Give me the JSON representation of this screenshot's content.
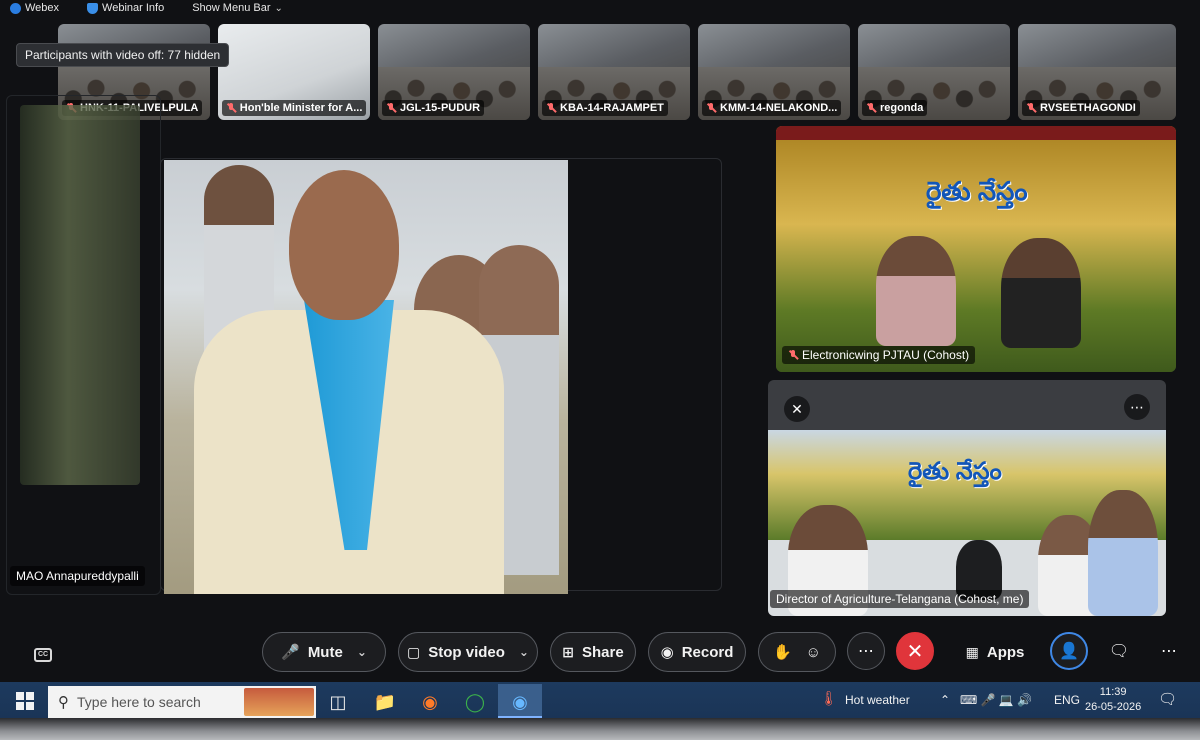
{
  "menubar": {
    "app_name": "Webex",
    "webinar_info": "Webinar Info",
    "show_menu_bar": "Show Menu Bar"
  },
  "tooltip": "Participants with video off: 77 hidden",
  "thumbnails": [
    {
      "label": "HNK-11-PALIVELPULA"
    },
    {
      "label": "Hon'ble Minister for A..."
    },
    {
      "label": "JGL-15-PUDUR"
    },
    {
      "label": "KBA-14-RAJAMPET"
    },
    {
      "label": "KMM-14-NELAKOND..."
    },
    {
      "label": "regonda"
    },
    {
      "label": "RVSEETHAGONDI"
    }
  ],
  "main_speaker": {
    "label": "MAO Annapureddypalli"
  },
  "tiles": [
    {
      "banner_text": "రైతు నేస్తం",
      "label": "Electronicwing PJTAU (Cohost)"
    },
    {
      "banner_text": "రైతు నేస్తం",
      "label": "Director of Agriculture-Telangana (Cohost, me)"
    }
  ],
  "controls": {
    "mute": "Mute",
    "stop_video": "Stop video",
    "share": "Share",
    "record": "Record",
    "apps": "Apps"
  },
  "taskbar": {
    "search_placeholder": "Type here to search",
    "weather": "Hot weather",
    "language": "ENG",
    "time": "11:39",
    "date": "26-05-2026"
  },
  "colors": {
    "end_call": "#e0353b",
    "accent": "#2a7de1",
    "taskbar": "#1a3456"
  }
}
